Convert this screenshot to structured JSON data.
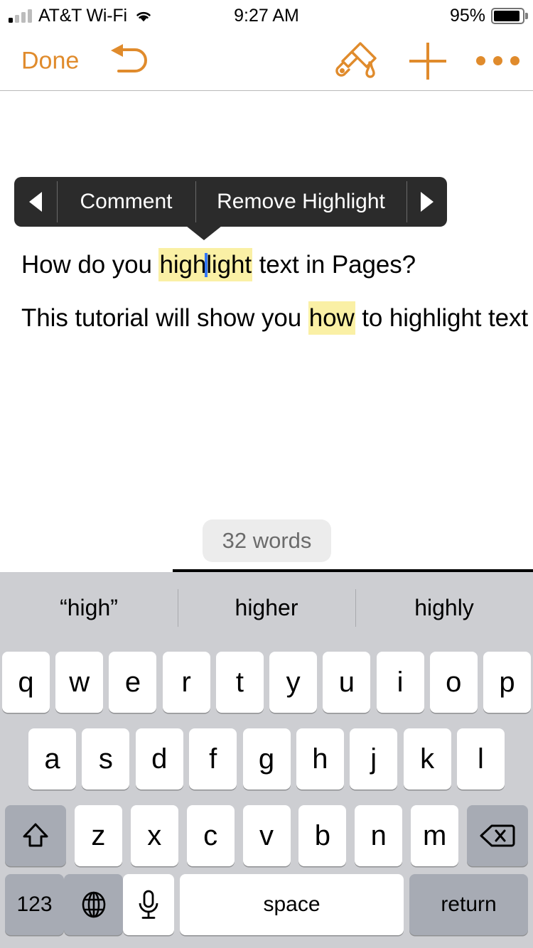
{
  "status_bar": {
    "carrier": "AT&T Wi-Fi",
    "time": "9:27 AM",
    "battery_percent": "95%",
    "wifi_icon": "wifi-icon",
    "signal_icon": "signal-bars-icon",
    "battery_icon": "battery-icon",
    "battery_level": 95,
    "signal_bars_filled": 1,
    "signal_bars_total": 4
  },
  "toolbar": {
    "done_label": "Done",
    "undo_icon": "undo-arrow-icon",
    "brush_icon": "paintbrush-icon",
    "add_icon": "plus-icon",
    "more_icon": "ellipsis-icon",
    "accent_color": "#E08B2C"
  },
  "edit_menu": {
    "prev_icon": "chevron-left-icon",
    "next_icon": "chevron-right-icon",
    "comment_label": "Comment",
    "remove_highlight_label": "Remove Highlight",
    "background_color": "#2B2B2B"
  },
  "document": {
    "line1": {
      "before": "How do you ",
      "highlight_a": "high",
      "highlight_b": "light",
      "after": " text in Pages?"
    },
    "line2": {
      "before": "This tutorial will show you ",
      "highlight": "how",
      "after": " to highlight text"
    },
    "highlight_color": "#FAF0A5",
    "caret_color": "#3478F6"
  },
  "word_count": {
    "label": "32 words"
  },
  "keyboard": {
    "predictions": [
      "“high”",
      "higher",
      "highly"
    ],
    "row1": [
      "q",
      "w",
      "e",
      "r",
      "t",
      "y",
      "u",
      "i",
      "o",
      "p"
    ],
    "row2": [
      "a",
      "s",
      "d",
      "f",
      "g",
      "h",
      "j",
      "k",
      "l"
    ],
    "row3": [
      "z",
      "x",
      "c",
      "v",
      "b",
      "n",
      "m"
    ],
    "shift_icon": "shift-arrow-icon",
    "backspace_icon": "backspace-delete-icon",
    "numbers_label": "123",
    "globe_icon": "globe-icon",
    "mic_icon": "microphone-icon",
    "space_label": "space",
    "return_label": "return",
    "background_color": "#cdced2"
  }
}
